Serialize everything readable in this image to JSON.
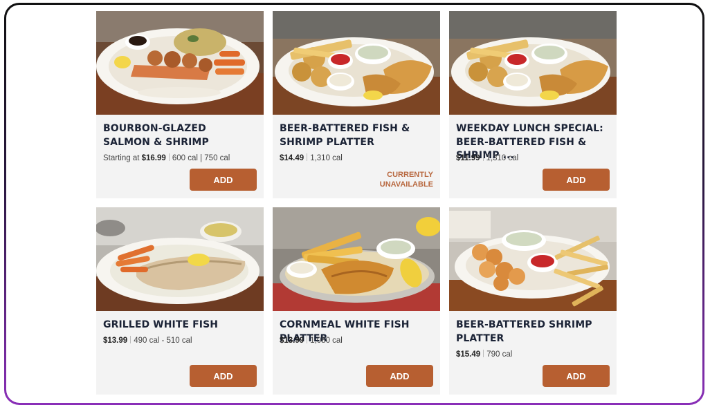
{
  "menu": {
    "items": [
      {
        "title": "BOURBON-GLAZED SALMON & SHRIMP",
        "price_prefix": "Starting at",
        "price": "$16.99",
        "calories": "600 cal | 750 cal",
        "action": "ADD",
        "image_icon": "salmon-shrimp-plate"
      },
      {
        "title": "BEER-BATTERED FISH & SHRIMP PLATTER",
        "price_prefix": "",
        "price": "$14.49",
        "calories": "1,310 cal",
        "status": "CURRENTLY UNAVAILABLE",
        "image_icon": "fried-platter"
      },
      {
        "title": "WEEKDAY LUNCH SPECIAL: BEER-BATTERED FISH & SHRIMP ...",
        "price_prefix": "",
        "price": "$11.99",
        "calories": "1,310 cal",
        "action": "ADD",
        "image_icon": "fried-platter"
      },
      {
        "title": "GRILLED WHITE FISH",
        "price_prefix": "",
        "price": "$13.99",
        "calories": "490 cal - 510 cal",
        "action": "ADD",
        "image_icon": "grilled-fish-plate"
      },
      {
        "title": "CORNMEAL WHITE FISH PLATTER",
        "price_prefix": "",
        "price": "$13.99",
        "calories": "1,080 cal",
        "action": "ADD",
        "image_icon": "cornmeal-fish-platter"
      },
      {
        "title": "BEER-BATTERED SHRIMP PLATTER",
        "price_prefix": "",
        "price": "$15.49",
        "calories": "790 cal",
        "action": "ADD",
        "image_icon": "shrimp-platter"
      }
    ]
  },
  "colors": {
    "accent": "#b75f31",
    "title_text": "#1b2336",
    "unavailable_text": "#b8683f",
    "card_bg": "#f3f3f3",
    "frame_gradient_bottom": "#8a2fb8"
  }
}
